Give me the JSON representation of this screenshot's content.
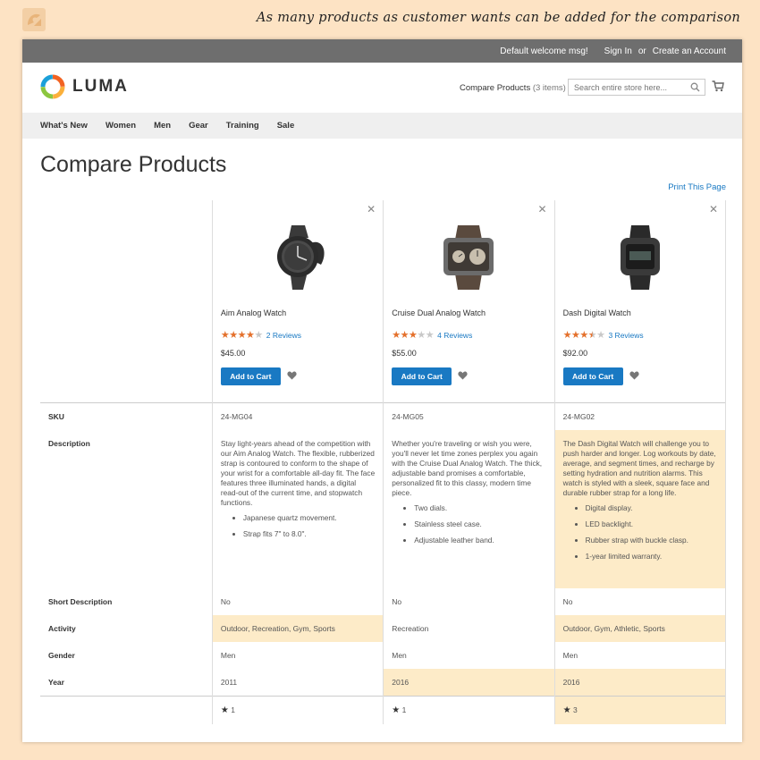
{
  "caption": "As many products as customer wants can be added for the comparison",
  "topbar": {
    "welcome": "Default welcome msg!",
    "sign_in": "Sign In",
    "or": "or",
    "create_account": "Create an Account"
  },
  "header": {
    "logo_text": "LUMA",
    "compare_label": "Compare Products",
    "compare_count": "(3 items)",
    "search_placeholder": "Search entire store here..."
  },
  "nav": [
    "What's New",
    "Women",
    "Men",
    "Gear",
    "Training",
    "Sale"
  ],
  "page": {
    "title": "Compare Products",
    "print_link": "Print This Page"
  },
  "colors": {
    "accent": "#1979c3",
    "star": "#e4702b",
    "highlight": "#fdebc8",
    "topbar": "#6e6e6e"
  },
  "products": [
    {
      "name": "Aim Analog Watch",
      "rating": 4,
      "rating_max": 5,
      "reviews": "2 Reviews",
      "price": "$45.00",
      "add_to_cart": "Add to Cart",
      "sku": "24-MG04",
      "description": "Stay light-years ahead of the competition with our Aim Analog Watch. The flexible, rubberized strap is contoured to conform to the shape of your wrist for a comfortable all-day fit. The face features three illuminated hands, a digital read-out of the current time, and stopwatch functions.",
      "bullets": [
        "Japanese quartz movement.",
        "Strap fits 7\" to 8.0\"."
      ],
      "short_description": "No",
      "activity": "Outdoor, Recreation, Gym, Sports",
      "gender": "Men",
      "year": "2011",
      "rating_count": "1"
    },
    {
      "name": "Cruise Dual Analog Watch",
      "rating": 3,
      "rating_max": 5,
      "reviews": "4 Reviews",
      "price": "$55.00",
      "add_to_cart": "Add to Cart",
      "sku": "24-MG05",
      "description": "Whether you're traveling or wish you were, you'll never let time zones perplex you again with the Cruise Dual Analog Watch. The thick, adjustable band promises a comfortable, personalized fit to this classy, modern time piece.",
      "bullets": [
        "Two dials.",
        "Stainless steel case.",
        "Adjustable leather band."
      ],
      "short_description": "No",
      "activity": "Recreation",
      "gender": "Men",
      "year": "2016",
      "rating_count": "1"
    },
    {
      "name": "Dash Digital Watch",
      "rating": 3.5,
      "rating_max": 5,
      "reviews": "3 Reviews",
      "price": "$92.00",
      "add_to_cart": "Add to Cart",
      "sku": "24-MG02",
      "description": "The Dash Digital Watch will challenge you to push harder and longer. Log workouts by date, average, and segment times, and recharge by setting hydration and nutrition alarms. This watch is styled with a sleek, square face and durable rubber strap for a long life.",
      "bullets": [
        "Digital display.",
        "LED backlight.",
        "Rubber strap with buckle clasp.",
        "1-year limited warranty."
      ],
      "short_description": "No",
      "activity": "Outdoor, Gym, Athletic, Sports",
      "gender": "Men",
      "year": "2016",
      "rating_count": "3"
    }
  ],
  "attributes": {
    "sku": "SKU",
    "description": "Description",
    "short_description": "Short Description",
    "activity": "Activity",
    "gender": "Gender",
    "year": "Year"
  }
}
